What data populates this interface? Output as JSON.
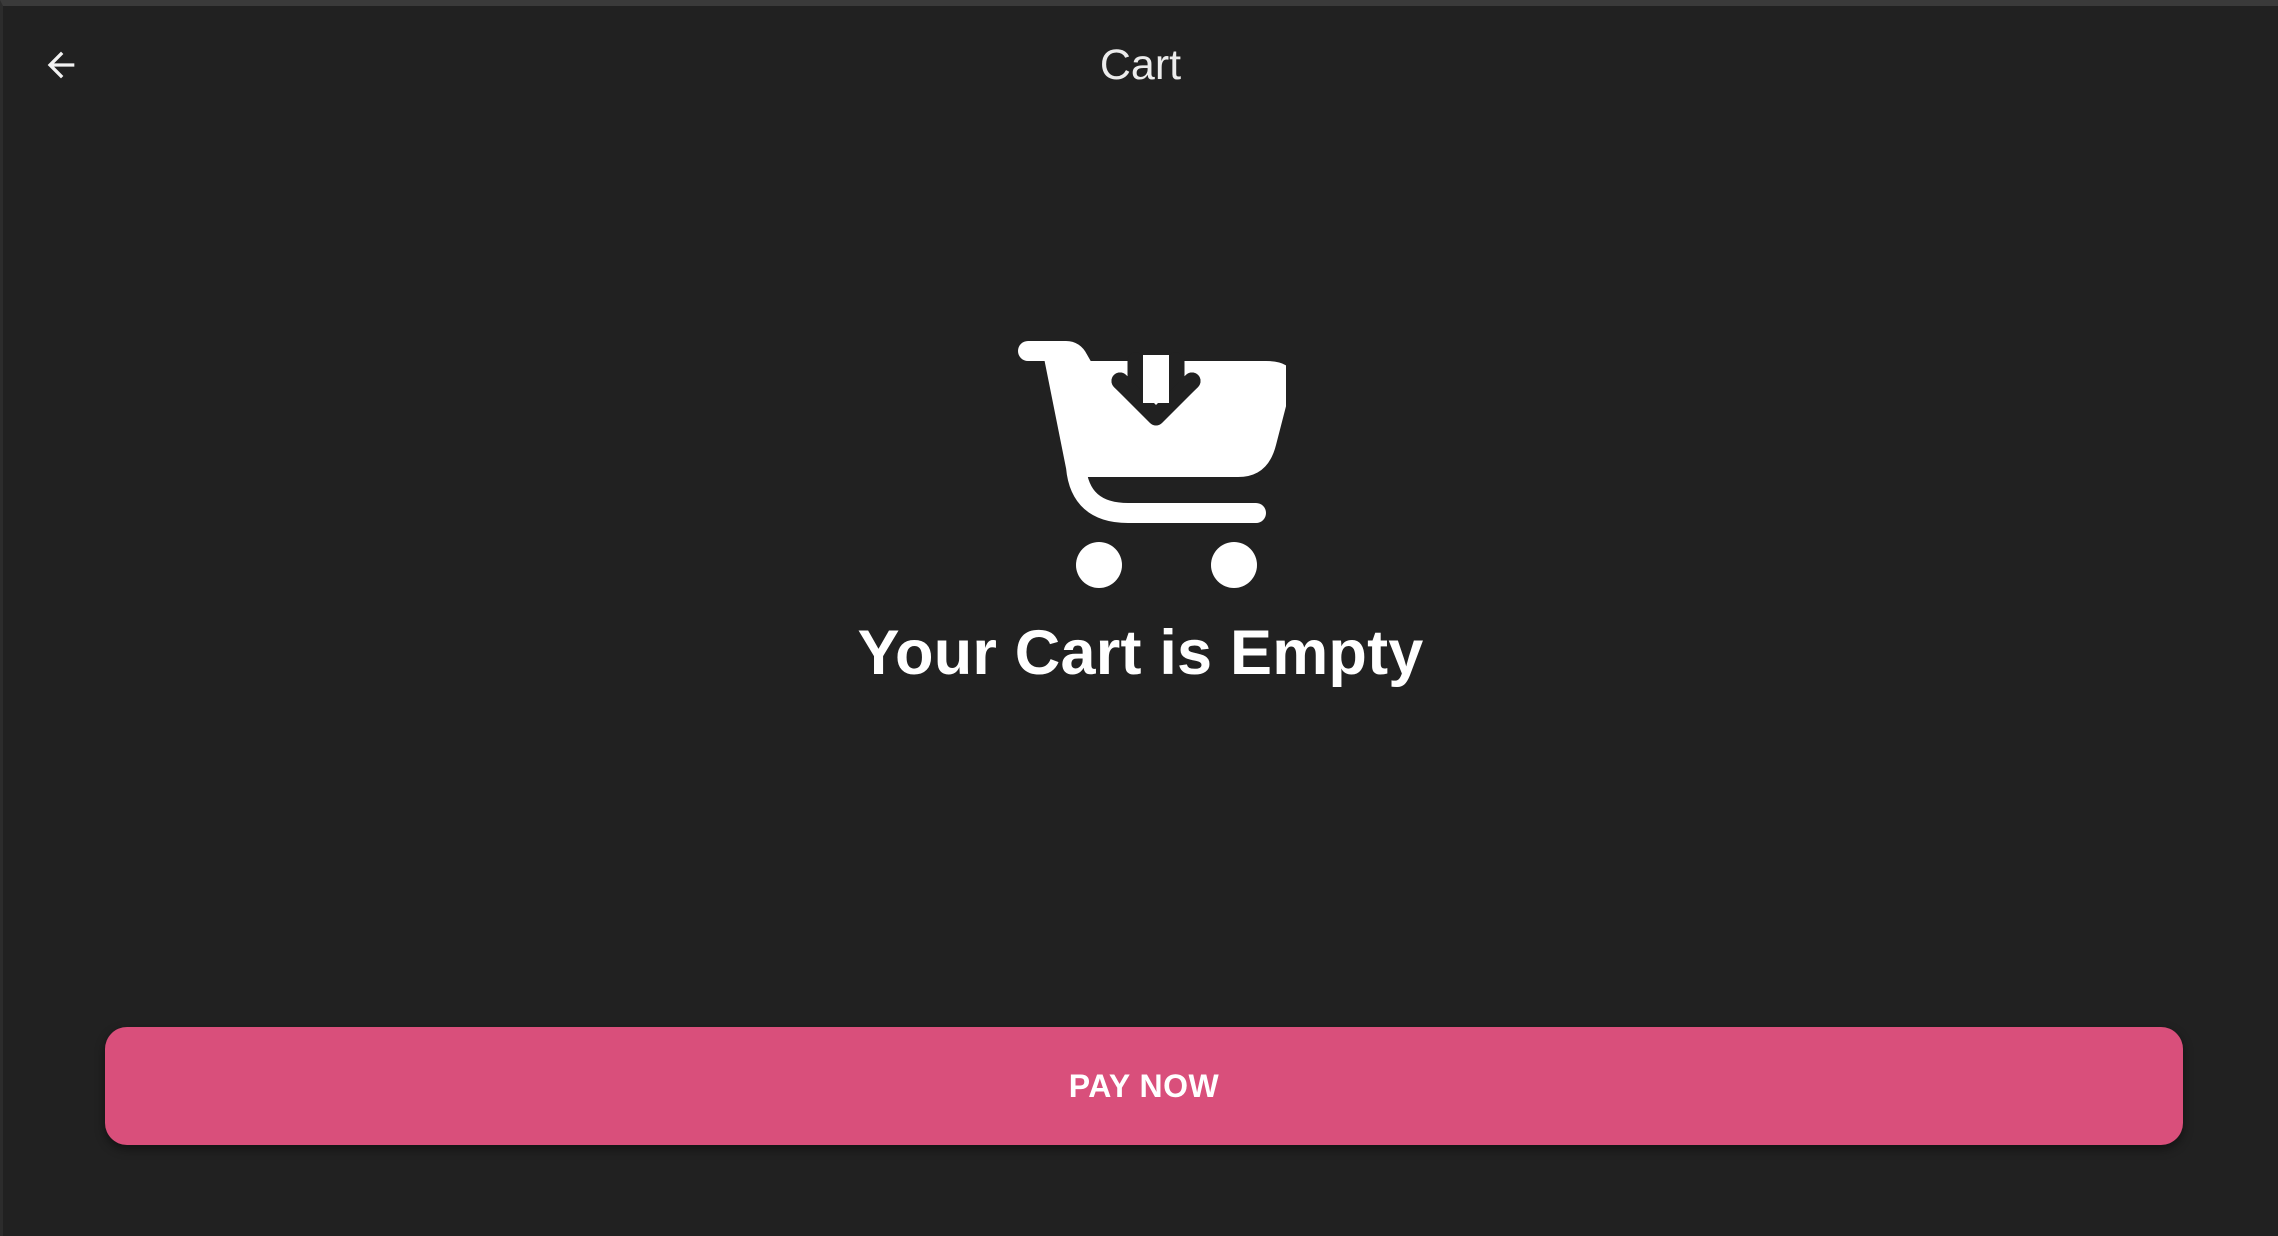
{
  "header": {
    "title": "Cart",
    "back_icon": "arrow-left-icon"
  },
  "empty_state": {
    "icon": "cart-download-icon",
    "message": "Your Cart is Empty"
  },
  "footer": {
    "pay_label": "PAY NOW"
  },
  "colors": {
    "background": "#212121",
    "accent": "#d94f7b",
    "text": "#ffffff"
  }
}
